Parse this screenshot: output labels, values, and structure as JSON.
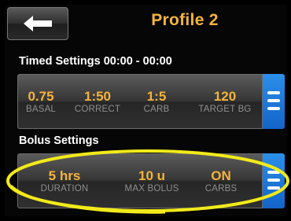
{
  "header": {
    "title": "Profile 2"
  },
  "timed_settings": {
    "label": "Timed Settings 00:00 - 00:00",
    "values": [
      {
        "value": "0.75",
        "label": "BASAL"
      },
      {
        "value": "1:50",
        "label": "CORRECT"
      },
      {
        "value": "1:5",
        "label": "CARB"
      },
      {
        "value": "120",
        "label": "TARGET BG"
      }
    ]
  },
  "bolus_settings": {
    "label": "Bolus Settings",
    "values": [
      {
        "value": "5 hrs",
        "label": "DURATION"
      },
      {
        "value": "10 u",
        "label": "MAX BOLUS"
      },
      {
        "value": "ON",
        "label": "CARBS"
      }
    ]
  },
  "icons": {
    "back": "left-arrow-icon",
    "menu": "hamburger-menu-icon"
  },
  "colors": {
    "accent": "#f5b43a",
    "menu_blue": "#1f7ad9",
    "highlight": "#f2ea1a"
  }
}
